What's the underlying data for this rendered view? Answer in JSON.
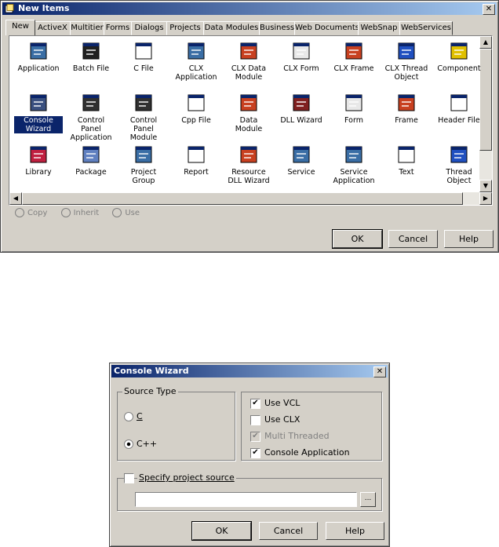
{
  "new_items": {
    "title": "New Items",
    "close": "✕",
    "tabs": [
      "New",
      "ActiveX",
      "Multitier",
      "Forms",
      "Dialogs",
      "Projects",
      "Data Modules",
      "Business",
      "Web Documents",
      "WebSnap",
      "WebServices"
    ],
    "items": [
      {
        "label": "Application",
        "icon": "application-icon"
      },
      {
        "label": "Batch File",
        "icon": "batch-file-icon"
      },
      {
        "label": "C File",
        "icon": "c-file-icon"
      },
      {
        "label": "CLX Application",
        "icon": "clx-application-icon"
      },
      {
        "label": "CLX Data Module",
        "icon": "clx-data-module-icon"
      },
      {
        "label": "CLX Form",
        "icon": "clx-form-icon"
      },
      {
        "label": "CLX Frame",
        "icon": "clx-frame-icon"
      },
      {
        "label": "CLX Thread Object",
        "icon": "clx-thread-object-icon"
      },
      {
        "label": "Component",
        "icon": "component-icon"
      },
      {
        "label": "Console Wizard",
        "icon": "console-wizard-icon",
        "selected": true
      },
      {
        "label": "Control Panel Application",
        "icon": "control-panel-application-icon"
      },
      {
        "label": "Control Panel Module",
        "icon": "control-panel-module-icon"
      },
      {
        "label": "Cpp File",
        "icon": "cpp-file-icon"
      },
      {
        "label": "Data Module",
        "icon": "data-module-icon"
      },
      {
        "label": "DLL Wizard",
        "icon": "dll-wizard-icon"
      },
      {
        "label": "Form",
        "icon": "form-icon"
      },
      {
        "label": "Frame",
        "icon": "frame-icon"
      },
      {
        "label": "Header File",
        "icon": "header-file-icon"
      },
      {
        "label": "Library",
        "icon": "library-icon"
      },
      {
        "label": "Package",
        "icon": "package-icon"
      },
      {
        "label": "Project Group",
        "icon": "project-group-icon"
      },
      {
        "label": "Report",
        "icon": "report-icon"
      },
      {
        "label": "Resource DLL Wizard",
        "icon": "resource-dll-wizard-icon"
      },
      {
        "label": "Service",
        "icon": "service-icon"
      },
      {
        "label": "Service Application",
        "icon": "service-application-icon"
      },
      {
        "label": "Text",
        "icon": "text-icon"
      },
      {
        "label": "Thread Object",
        "icon": "thread-object-icon"
      }
    ],
    "radios": [
      "Copy",
      "Inherit",
      "Use"
    ],
    "ok": "OK",
    "cancel": "Cancel",
    "help": "Help"
  },
  "console_wizard": {
    "title": "Console Wizard",
    "close": "✕",
    "source_type": {
      "title": "Source Type",
      "c": "C",
      "cpp": "C++",
      "selected": "C++"
    },
    "options": [
      {
        "label": "Use VCL",
        "checked": true,
        "enabled": true
      },
      {
        "label": "Use CLX",
        "checked": false,
        "enabled": true
      },
      {
        "label": "Multi Threaded",
        "checked": true,
        "enabled": false
      },
      {
        "label": "Console Application",
        "checked": true,
        "enabled": true
      }
    ],
    "specify_source": {
      "label": "Specify project source",
      "checked": false,
      "value": "",
      "browse": "..."
    },
    "ok": "OK",
    "cancel": "Cancel",
    "help": "Help"
  },
  "colors": {
    "face": "#d4d0c8",
    "title_start": "#0a246a",
    "title_end": "#a6caf0",
    "selection": "#0a246a"
  }
}
